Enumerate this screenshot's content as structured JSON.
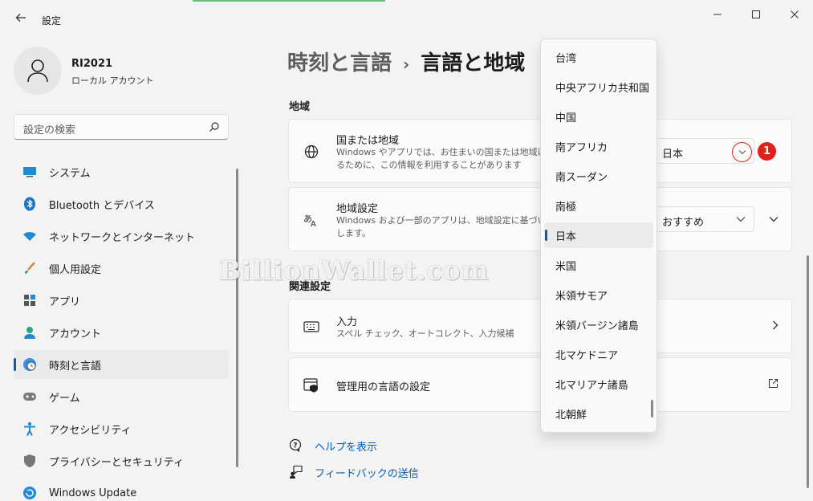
{
  "window": {
    "title": "設定"
  },
  "profile": {
    "name": "RI2021",
    "account_type": "ローカル アカウント"
  },
  "search": {
    "placeholder": "設定の検索"
  },
  "nav": {
    "items": [
      {
        "label": "システム",
        "icon": "monitor-icon"
      },
      {
        "label": "Bluetooth とデバイス",
        "icon": "bluetooth-icon"
      },
      {
        "label": "ネットワークとインターネット",
        "icon": "wifi-icon"
      },
      {
        "label": "個人用設定",
        "icon": "brush-icon"
      },
      {
        "label": "アプリ",
        "icon": "apps-icon"
      },
      {
        "label": "アカウント",
        "icon": "person-icon"
      },
      {
        "label": "時刻と言語",
        "icon": "clock-globe-icon",
        "active": true
      },
      {
        "label": "ゲーム",
        "icon": "gamepad-icon"
      },
      {
        "label": "アクセシビリティ",
        "icon": "accessibility-icon"
      },
      {
        "label": "プライバシーとセキュリティ",
        "icon": "shield-icon"
      },
      {
        "label": "Windows Update",
        "icon": "update-icon"
      }
    ]
  },
  "breadcrumb": {
    "parent": "時刻と言語",
    "separator": "›",
    "current": "言語と地域"
  },
  "region_section": {
    "title": "地域",
    "country": {
      "title": "国または地域",
      "desc_line1": "Windows やアプリでは、お住まいの国または地域に対",
      "desc_line2": "るために、この情報を利用することがあります",
      "value": "日本"
    },
    "format": {
      "title": "地域設定",
      "desc_line1": "Windows および一部のアプリは、地域設定に基づいて",
      "desc_line2": "します。",
      "value": "おすすめ"
    }
  },
  "related_section": {
    "title": "関連設定",
    "input": {
      "title": "入力",
      "desc": "スペル チェック、オートコレクト、入力候補"
    },
    "admin": {
      "title": "管理用の言語の設定"
    }
  },
  "links": {
    "help": "ヘルプを表示",
    "feedback": "フィードバックの送信"
  },
  "dropdown": {
    "options": [
      "台湾",
      "中央アフリカ共和国",
      "中国",
      "南アフリカ",
      "南スーダン",
      "南極",
      "日本",
      "米国",
      "米領サモア",
      "米領バージン諸島",
      "北マケドニア",
      "北マリアナ諸島",
      "北朝鮮"
    ],
    "selected_index": 6
  },
  "annotation": {
    "step": "1"
  },
  "watermark": "BillionWallet.com",
  "colors": {
    "accent": "#005fb8",
    "highlight": "#e0201b"
  }
}
